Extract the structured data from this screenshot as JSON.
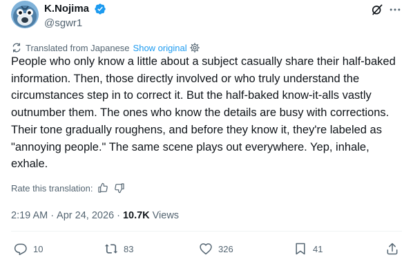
{
  "author": {
    "display_name": "K.Nojima",
    "handle": "@sgwr1",
    "avatar": "avatar",
    "verified": "verified-badge-icon"
  },
  "header_icons": {
    "grok": "grok-icon",
    "more": "more-icon"
  },
  "translation": {
    "notice": "Translated from Japanese",
    "show_original": "Show original",
    "rate_label": "Rate this translation:"
  },
  "tweet": {
    "text": "People who only know a little about a subject casually share their half-baked information. Then, those directly involved or who truly understand the circumstances step in to correct it. But the half-baked know-it-alls vastly outnumber them. The ones who know the details are busy with corrections. Their tone gradually roughens, and before they know it, they're labeled as \"annoying people.\" The same scene plays out everywhere. Yep, inhale, exhale."
  },
  "meta": {
    "time": "2:19 AM",
    "date": "Apr 24, 2026",
    "separator": "·",
    "views_count": "10.7K",
    "views_label": "Views"
  },
  "actions": {
    "replies": "10",
    "reposts": "83",
    "likes": "326",
    "bookmarks": "41"
  },
  "colors": {
    "accent": "#1d9bf0",
    "text_primary": "#0f1419",
    "text_secondary": "#536471",
    "divider": "#eff3f4"
  }
}
